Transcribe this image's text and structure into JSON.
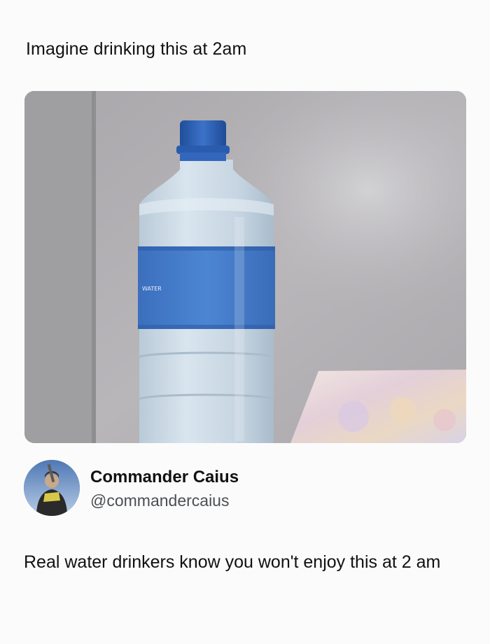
{
  "post": {
    "text": "Imagine drinking this at 2am"
  },
  "image": {
    "label_text": "WATER"
  },
  "reply": {
    "display_name": "Commander Caius",
    "handle": "@commandercaius",
    "text": "Real water drinkers know you won't enjoy this at 2 am"
  },
  "colors": {
    "background": "#fbfbfb",
    "text": "#111111",
    "handle": "#4b4f54",
    "bottle_cap": "#2f62b8",
    "bottle_label": "#3c74c4"
  }
}
